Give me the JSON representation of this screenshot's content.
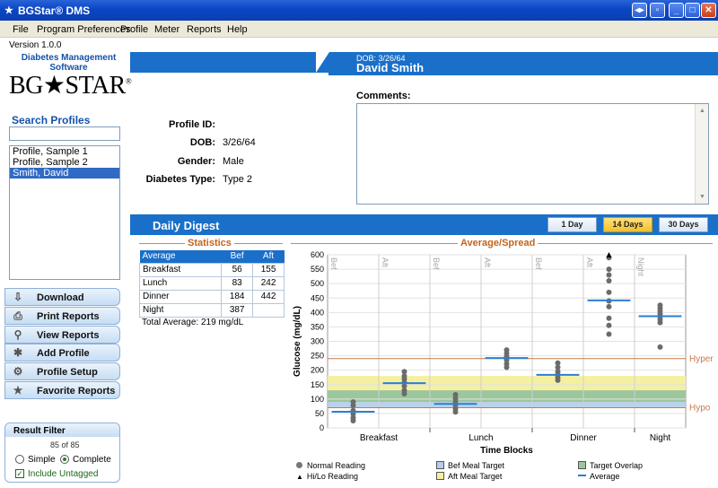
{
  "window": {
    "title": "BGStar® DMS"
  },
  "menu": [
    "File",
    "Program Preferences",
    "Profile",
    "Meter",
    "Reports",
    "Help"
  ],
  "version": "Version 1.0.0",
  "brand": {
    "subtitle_line1": "Diabetes Management",
    "subtitle_line2": "Software",
    "logo": "BG★STAR"
  },
  "search": {
    "label": "Search Profiles",
    "value": ""
  },
  "profiles": [
    {
      "name": "Profile, Sample 1"
    },
    {
      "name": "Profile, Sample 2"
    },
    {
      "name": "Smith, David",
      "selected": true
    }
  ],
  "nav": [
    {
      "label": "Download",
      "icon": "download-icon"
    },
    {
      "label": "Print Reports",
      "icon": "printer-icon"
    },
    {
      "label": "View Reports",
      "icon": "magnifier-icon"
    },
    {
      "label": "Add Profile",
      "icon": "add-profile-icon"
    },
    {
      "label": "Profile Setup",
      "icon": "profile-setup-icon"
    },
    {
      "label": "Favorite Reports",
      "icon": "star-icon"
    }
  ],
  "filter": {
    "title": "Result Filter",
    "count": "85  of 85",
    "simple": "Simple",
    "complete": "Complete",
    "include": "Include Untagged",
    "mode": "complete",
    "include_checked": true
  },
  "patient": {
    "dob_small": "DOB: 3/26/64",
    "name": "David Smith",
    "profile_id_label": "Profile ID:",
    "profile_id": "",
    "dob_label": "DOB:",
    "dob": "3/26/64",
    "gender_label": "Gender:",
    "gender": "Male",
    "diabetes_label": "Diabetes Type:",
    "diabetes_type": "Type 2",
    "comments_label": "Comments:",
    "comments": ""
  },
  "digest": {
    "title": "Daily Digest",
    "buttons": [
      {
        "label": "1 Day"
      },
      {
        "label": "14 Days",
        "active": true
      },
      {
        "label": "30 Days"
      }
    ]
  },
  "statistics": {
    "title": "Statistics",
    "headers": [
      "Average",
      "Bef",
      "Aft"
    ],
    "rows": [
      [
        "Breakfast",
        "56",
        "155"
      ],
      [
        "Lunch",
        "83",
        "242"
      ],
      [
        "Dinner",
        "184",
        "442"
      ],
      [
        "Night",
        "387",
        ""
      ]
    ],
    "total": "Total Average:  219 mg/dL"
  },
  "colors": {
    "accent": "#1a6fc9",
    "section": "#c2641d",
    "avg_line": "#2a7fd4",
    "bef_target": "#b5cde6",
    "aft_target": "#f5f0a0",
    "overlap": "#9bc79b",
    "limit_line": "#c97a4a"
  },
  "chart_data": {
    "type": "scatter",
    "title": "Average/Spread",
    "xlabel": "Time Blocks",
    "ylabel": "Glucose (mg/dL)",
    "ylim": [
      0,
      600
    ],
    "yticks": [
      0,
      50,
      100,
      150,
      200,
      250,
      300,
      350,
      400,
      450,
      500,
      550,
      600
    ],
    "categories": [
      "Breakfast",
      "Lunch",
      "Dinner",
      "Night"
    ],
    "subcolumns": [
      "Bef",
      "Aft",
      "Bef",
      "Aft",
      "Bef",
      "Aft",
      "Night"
    ],
    "hyper": {
      "label": "Hyper",
      "value": 240
    },
    "hypo": {
      "label": "Hypo",
      "value": 70
    },
    "bef_target": [
      70,
      130
    ],
    "aft_target": [
      90,
      180
    ],
    "averages": [
      56,
      155,
      83,
      242,
      184,
      442,
      387
    ],
    "readings": [
      [
        90,
        78,
        60,
        48,
        35,
        25
      ],
      [
        195,
        180,
        170,
        158,
        145,
        130,
        118
      ],
      [
        115,
        102,
        90,
        78,
        65,
        55
      ],
      [
        270,
        258,
        248,
        235,
        222,
        210
      ],
      [
        225,
        210,
        195,
        185,
        175,
        165
      ],
      [
        590,
        550,
        530,
        510,
        470,
        440,
        420,
        380,
        355,
        325
      ],
      [
        425,
        415,
        405,
        395,
        385,
        375,
        365,
        280
      ]
    ],
    "hilo": [
      {
        "col": 5,
        "value": 600
      }
    ],
    "legend": [
      "Normal Reading",
      "Hi/Lo Reading",
      "Bef Meal Target",
      "Aft Meal Target",
      "Target Overlap",
      "Average"
    ]
  }
}
